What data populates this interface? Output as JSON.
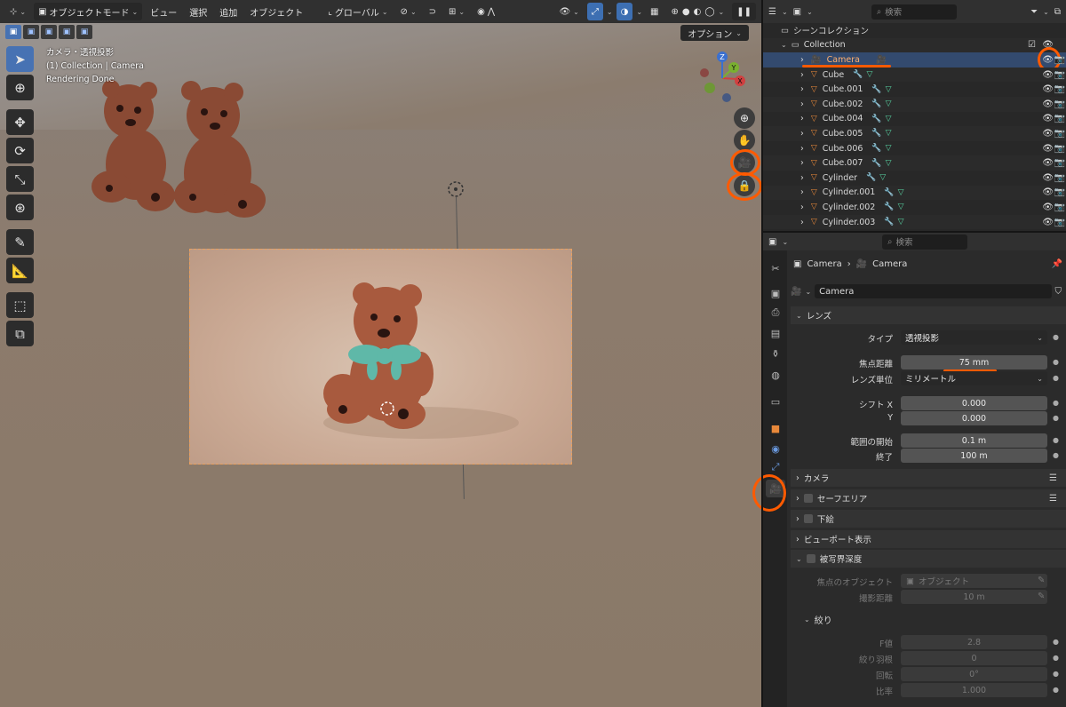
{
  "header": {
    "mode": "オブジェクトモード",
    "menus": [
      "ビュー",
      "選択",
      "追加",
      "オブジェクト"
    ],
    "transform": "グローバル",
    "options": "オプション"
  },
  "viewport_info": {
    "line1": "カメラ・透視投影",
    "line2": "(1) Collection | Camera",
    "line3": "Rendering Done"
  },
  "gizmo": {
    "x": "X",
    "y": "Y",
    "z": "Z"
  },
  "outliner": {
    "search_placeholder": "検索",
    "scene_collection": "シーンコレクション",
    "collection": "Collection",
    "items": [
      {
        "name": "Camera",
        "type": "camera"
      },
      {
        "name": "Cube",
        "type": "mesh"
      },
      {
        "name": "Cube.001",
        "type": "mesh"
      },
      {
        "name": "Cube.002",
        "type": "mesh"
      },
      {
        "name": "Cube.004",
        "type": "mesh"
      },
      {
        "name": "Cube.005",
        "type": "mesh"
      },
      {
        "name": "Cube.006",
        "type": "mesh"
      },
      {
        "name": "Cube.007",
        "type": "mesh"
      },
      {
        "name": "Cylinder",
        "type": "mesh"
      },
      {
        "name": "Cylinder.001",
        "type": "mesh"
      },
      {
        "name": "Cylinder.002",
        "type": "mesh"
      },
      {
        "name": "Cylinder.003",
        "type": "mesh"
      }
    ]
  },
  "properties": {
    "search_placeholder": "検索",
    "breadcrumb": [
      "Camera",
      "Camera"
    ],
    "datablock": "Camera",
    "lens": {
      "title": "レンズ",
      "type_label": "タイプ",
      "type_value": "透視投影",
      "focal_label": "焦点距離",
      "focal_value": "75 mm",
      "unit_label": "レンズ単位",
      "unit_value": "ミリメートル",
      "shiftx_label": "シフト X",
      "shiftx_value": "0.000",
      "shifty_label": "Y",
      "shifty_value": "0.000",
      "clipstart_label": "範囲の開始",
      "clipstart_value": "0.1 m",
      "clipend_label": "終了",
      "clipend_value": "100 m"
    },
    "panels": {
      "camera": "カメラ",
      "safe": "セーフエリア",
      "background": "下絵",
      "viewport_display": "ビューポート表示",
      "dof": "被写界深度"
    },
    "dof": {
      "focus_object_label": "焦点のオブジェクト",
      "focus_object_placeholder": "オブジェクト",
      "distance_label": "撮影距離",
      "distance_value": "10 m",
      "aperture_title": "絞り",
      "fstop_label": "F値",
      "fstop_value": "2.8",
      "blades_label": "絞り羽根",
      "blades_value": "0",
      "rotation_label": "回転",
      "rotation_value": "0°",
      "ratio_label": "比率",
      "ratio_value": "1.000"
    }
  },
  "colors": {
    "annotation": "#ff5a00",
    "selection": "#4772b3",
    "camera_data_tab": "#5fd0a0"
  }
}
